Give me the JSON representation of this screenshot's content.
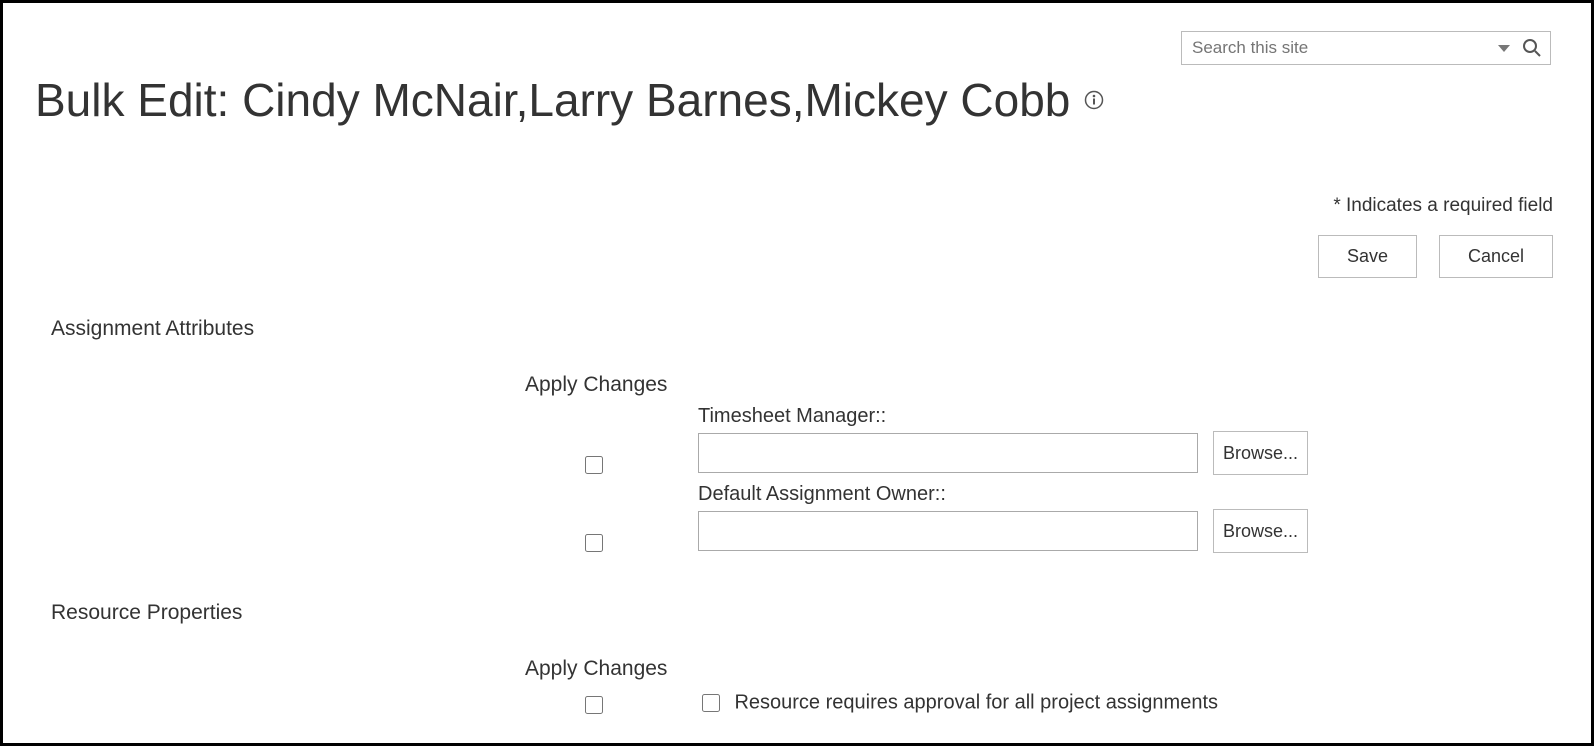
{
  "search": {
    "placeholder": "Search this site"
  },
  "page_title": "Bulk Edit: Cindy McNair,Larry Barnes,Mickey Cobb",
  "required_note": "* Indicates a required field",
  "buttons": {
    "save": "Save",
    "cancel": "Cancel"
  },
  "sections": {
    "assignment_attributes": {
      "heading": "Assignment Attributes",
      "apply_label": "Apply Changes",
      "fields": {
        "timesheet_manager": {
          "label": "Timesheet Manager::",
          "value": "",
          "browse": "Browse..."
        },
        "default_assignment_owner": {
          "label": "Default Assignment Owner::",
          "value": "",
          "browse": "Browse..."
        }
      }
    },
    "resource_properties": {
      "heading": "Resource Properties",
      "apply_label": "Apply Changes",
      "fields": {
        "requires_approval": {
          "label": "Resource requires approval for all project assignments"
        }
      }
    }
  }
}
